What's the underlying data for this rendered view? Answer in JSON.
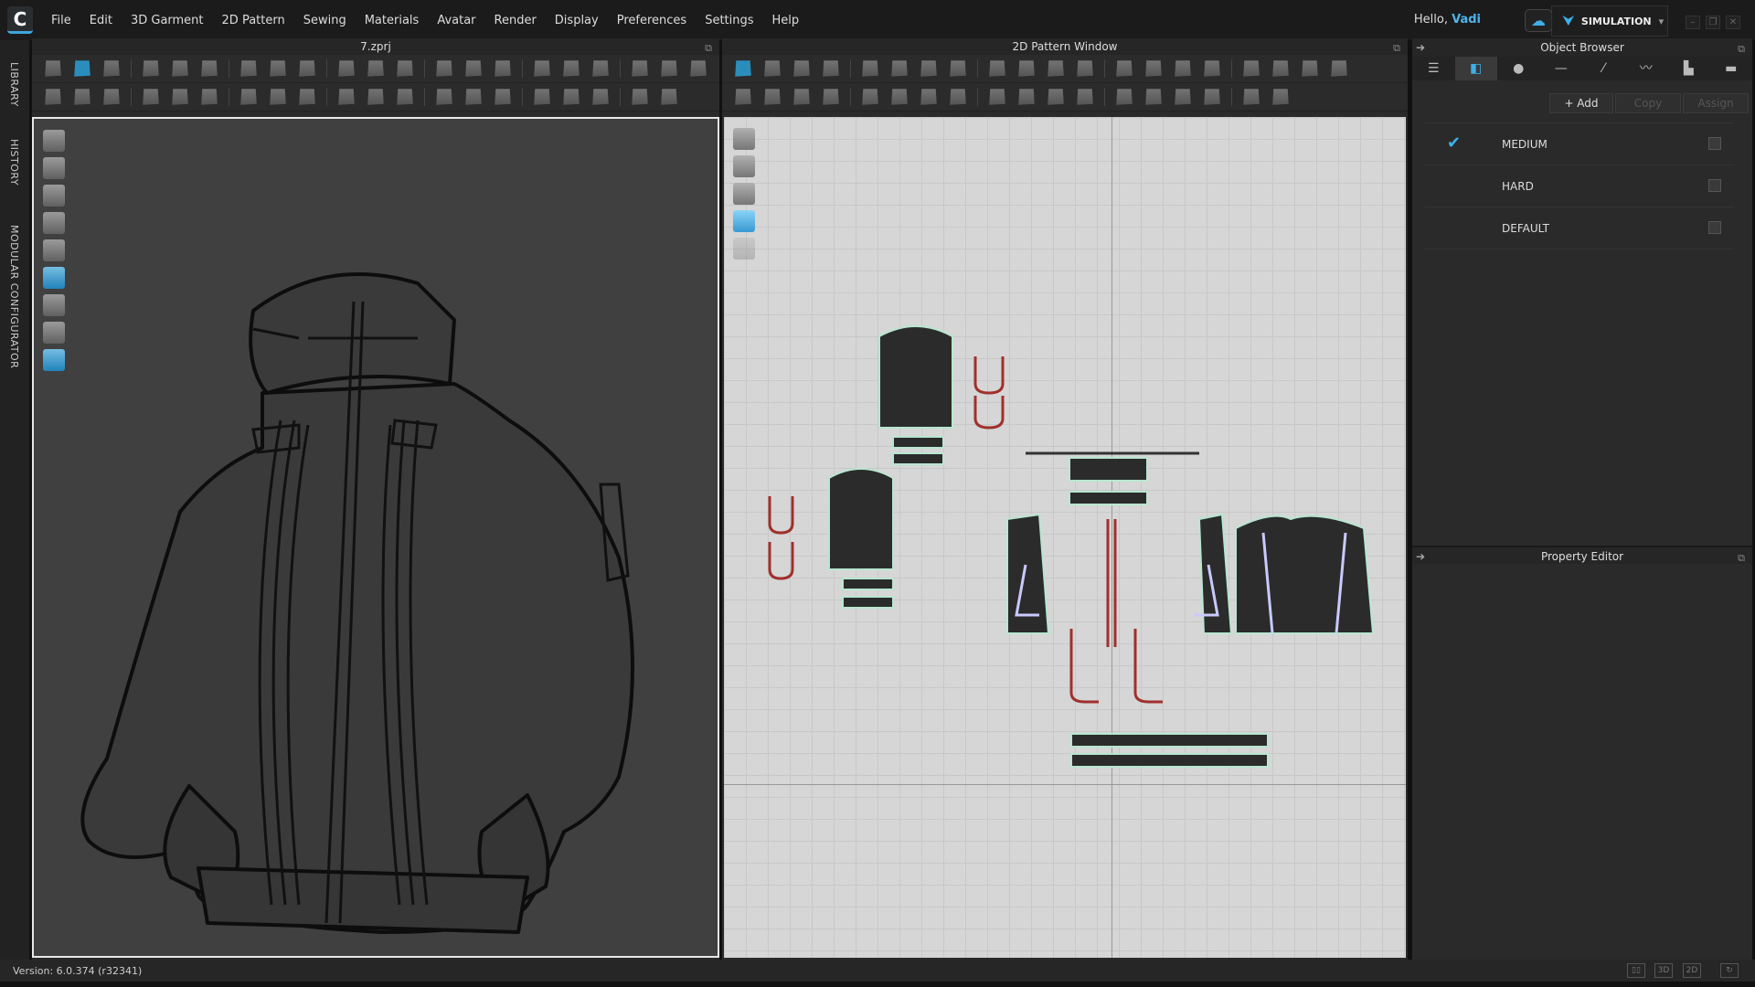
{
  "menubar": {
    "items": [
      "File",
      "Edit",
      "3D Garment",
      "2D Pattern",
      "Sewing",
      "Materials",
      "Avatar",
      "Render",
      "Display",
      "Preferences",
      "Settings",
      "Help"
    ],
    "greeting": "Hello,",
    "user": "Vadi",
    "mode": "SIMULATION"
  },
  "sidebar": {
    "tabs": [
      "LIBRARY",
      "HISTORY",
      "MODULAR CONFIGURATOR"
    ]
  },
  "window3d": {
    "title": "7.zprj"
  },
  "window2d": {
    "title": "2D Pattern Window"
  },
  "object_browser": {
    "title": "Object Browser",
    "buttons": {
      "add": "+ Add",
      "copy": "Copy",
      "assign": "Assign"
    },
    "items": [
      {
        "name": "MEDIUM",
        "checked": true
      },
      {
        "name": "HARD",
        "checked": false
      },
      {
        "name": "DEFAULT",
        "checked": false
      }
    ]
  },
  "property_editor": {
    "title": "Property Editor"
  },
  "status": {
    "version": "Version: 6.0.374 (r32341)",
    "view_buttons": [
      "3D",
      "2D"
    ]
  },
  "colors": {
    "accent": "#3db0ea"
  }
}
